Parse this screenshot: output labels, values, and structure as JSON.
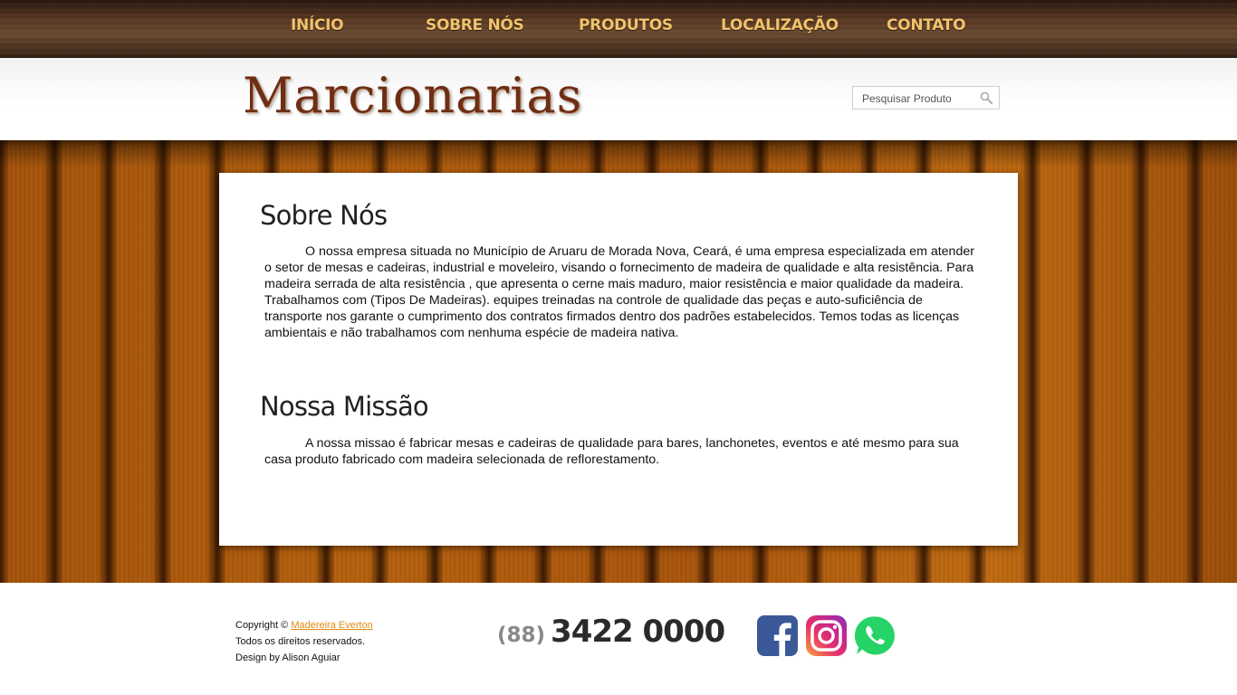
{
  "nav": {
    "items": [
      "INÍCIO",
      "SOBRE NÓS",
      "PRODUTOS",
      "LOCALIZAÇÃO",
      "CONTATO"
    ]
  },
  "header": {
    "logo_text": "Marcionarias",
    "search_placeholder": "Pesquisar Produto"
  },
  "about": {
    "title": "Sobre Nós",
    "text": "O nossa empresa situada no Município de Aruaru de Morada Nova, Ceará, é uma empresa especializada em atender o setor de mesas e cadeiras, industrial e moveleiro, visando o fornecimento de madeira de qualidade e alta resistência. Para madeira serrada de alta resistência , que apresenta o cerne mais maduro, maior resistência e maior qualidade da madeira. Trabalhamos com (Tipos De Madeiras). equipes treinadas na controle de qualidade das peças e auto-suficiência de transporte nos garante o cumprimento dos contratos firmados dentro dos padrões estabelecidos. Temos todas as licenças ambientais e não trabalhamos com nenhuma espécie de madeira nativa."
  },
  "mission": {
    "title": "Nossa Missão",
    "text": "A nossa missao é fabricar mesas e cadeiras de qualidade para bares, lanchonetes, eventos e até mesmo para sua casa produto fabricado com madeira selecionada de reflorestamento."
  },
  "footer": {
    "copyright_prefix": "Copyright ©",
    "copyright_link": "Madereira Everton",
    "rights": "Todos os direitos reservados.",
    "design": "Design by Alison Aguiar",
    "phone_ddd": "(88)",
    "phone_number": "3422 0000"
  },
  "social": [
    "facebook-icon",
    "instagram-icon",
    "whatsapp-icon"
  ],
  "colors": {
    "nav_text": "#f2c26a",
    "logo": "#6e2e14",
    "link": "#e08a10",
    "facebook": "#3b5998",
    "whatsapp": "#25d366"
  }
}
